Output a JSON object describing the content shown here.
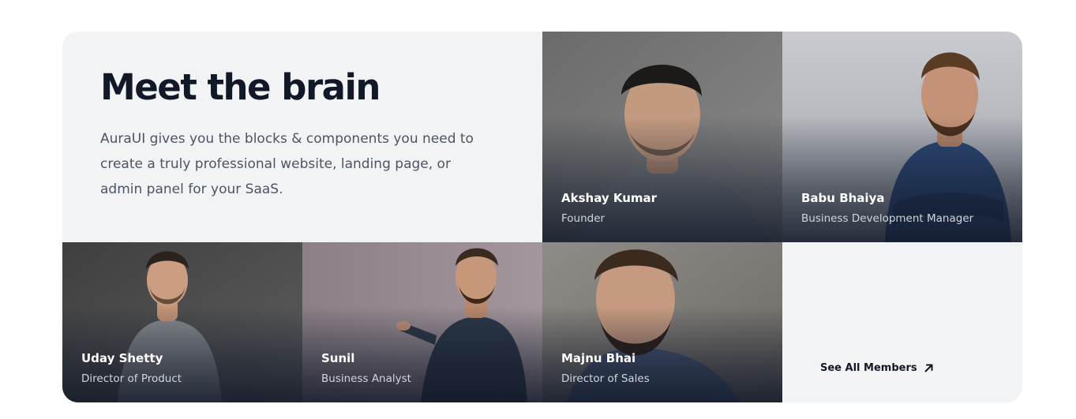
{
  "team": {
    "title": "Meet the brain",
    "description": "AuraUI gives you the blocks & components you need to create a truly professional website, landing page, or admin panel for your SaaS.",
    "see_all_label": "See All Members",
    "see_all_icon": "arrow-up-right-icon",
    "members": [
      {
        "name": "Akshay Kumar",
        "role": "Founder"
      },
      {
        "name": "Babu Bhaiya",
        "role": "Business Development Manager"
      },
      {
        "name": "Uday Shetty",
        "role": "Director of Product"
      },
      {
        "name": "Sunil",
        "role": "Business Analyst"
      },
      {
        "name": "Majnu Bhai",
        "role": "Director of Sales"
      }
    ]
  },
  "colors": {
    "heading": "#111827",
    "body_text": "#4b5563",
    "panel_bg": "#f2f3f5"
  }
}
